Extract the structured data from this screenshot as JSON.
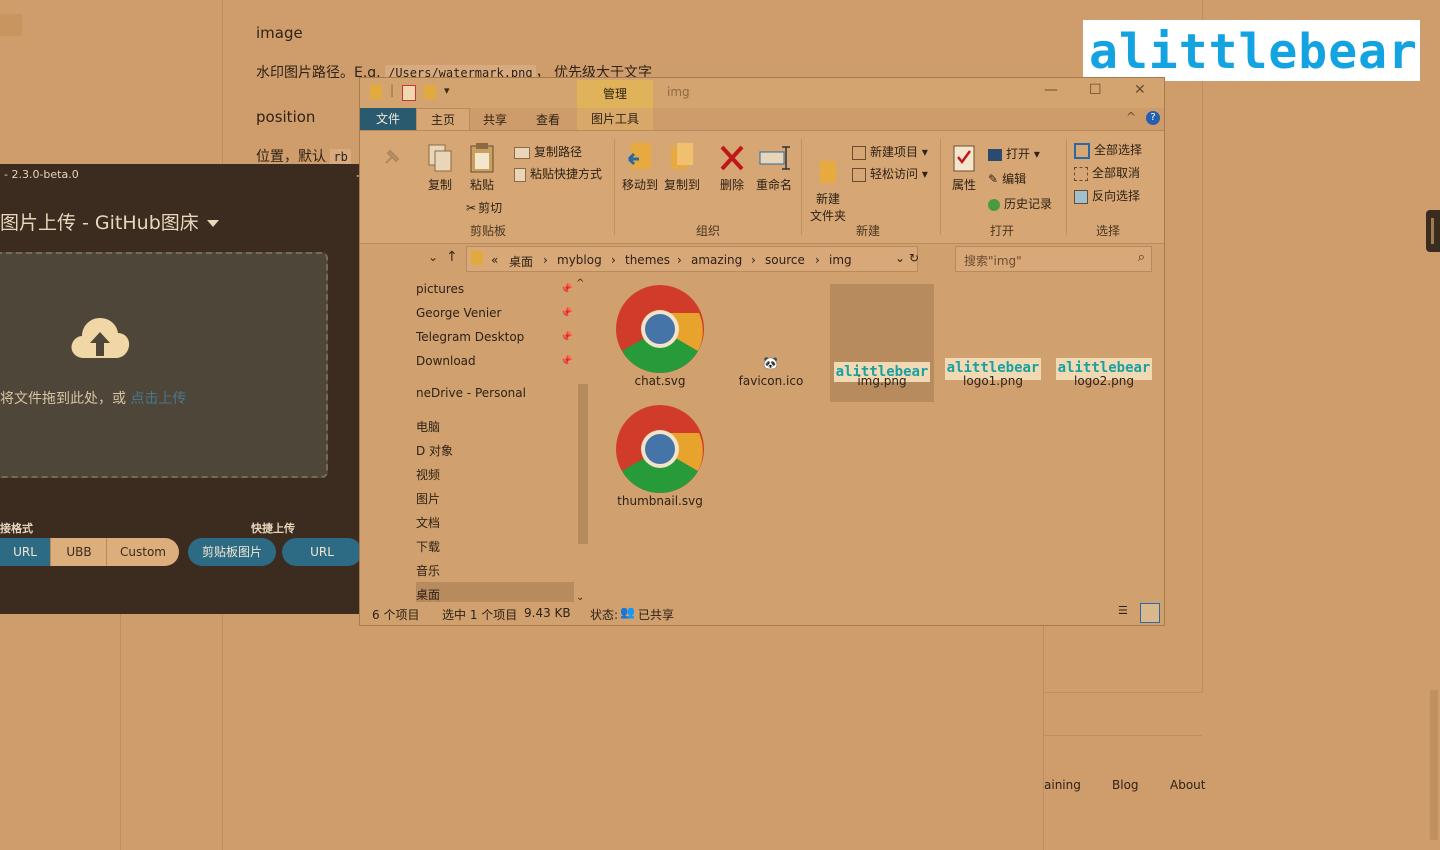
{
  "background_page": {
    "heading_image": "image",
    "para_image": "水印图片路径。E.g.",
    "para_image_code": "/Users/watermark.png",
    "para_image_suffix": "， 优先级大于文字",
    "heading_position": "position",
    "para_position": "位置，默认",
    "para_position_code": "rb",
    "footer_links": [
      "aining",
      "Blog",
      "About"
    ]
  },
  "watermark_logo": "alittlebear",
  "picgo": {
    "title": "- 2.3.0-beta.0",
    "heading": "图片上传 - GitHub图床",
    "drop_hint": "将文件拖到此处，或",
    "drop_link": "点击上传",
    "link_format_label": "接格式",
    "quick_upload_label": "快捷上传",
    "format_buttons": [
      "URL",
      "UBB",
      "Custom"
    ],
    "quick_buttons": [
      "剪贴板图片",
      "URL"
    ]
  },
  "explorer": {
    "title": "img",
    "manage_tab": "管理",
    "picture_tools_tab": "图片工具",
    "tabs": [
      "文件",
      "主页",
      "共享",
      "查看"
    ],
    "ribbon": {
      "clipboard": {
        "group": "剪贴板",
        "copy": "复制",
        "paste": "粘贴",
        "copy_path": "复制路径",
        "paste_shortcut": "粘贴快捷方式",
        "cut": "剪切"
      },
      "organize": {
        "group": "组织",
        "move_to": "移动到",
        "copy_to": "复制到",
        "delete": "删除",
        "rename": "重命名"
      },
      "new": {
        "group": "新建",
        "new_folder": "新建\n文件夹",
        "new_item": "新建项目",
        "easy_access": "轻松访问"
      },
      "open": {
        "group": "打开",
        "properties": "属性",
        "open": "打开",
        "edit": "编辑",
        "history": "历史记录"
      },
      "select": {
        "group": "选择",
        "select_all": "全部选择",
        "select_none": "全部取消",
        "invert": "反向选择"
      }
    },
    "address": {
      "prefix": "«",
      "segments": [
        "桌面",
        "myblog",
        "themes",
        "amazing",
        "source",
        "img"
      ],
      "search_placeholder": "搜索\"img\""
    },
    "nav_items": [
      "pictures",
      "George Venier",
      "Telegram Desktop",
      "Download",
      "neDrive - Personal",
      "电脑",
      "D 对象",
      "视频",
      "图片",
      "文档",
      "下载",
      "音乐",
      "桌面"
    ],
    "files": [
      {
        "name": "chat.svg",
        "icon": "chrome-icon"
      },
      {
        "name": "favicon.ico",
        "icon": "panda-icon"
      },
      {
        "name": "img.png",
        "icon": "logo-thumb",
        "selected": true
      },
      {
        "name": "logo1.png",
        "icon": "logo-thumb"
      },
      {
        "name": "logo2.png",
        "icon": "logo-thumb"
      },
      {
        "name": "thumbnail.svg",
        "icon": "chrome-icon"
      }
    ],
    "logo_thumb_text": "alittlebear",
    "status": {
      "count": "6 个项目",
      "selected": "选中 1 个项目",
      "size": "9.43 KB",
      "state_label": "状态:",
      "state_value": "已共享"
    }
  }
}
